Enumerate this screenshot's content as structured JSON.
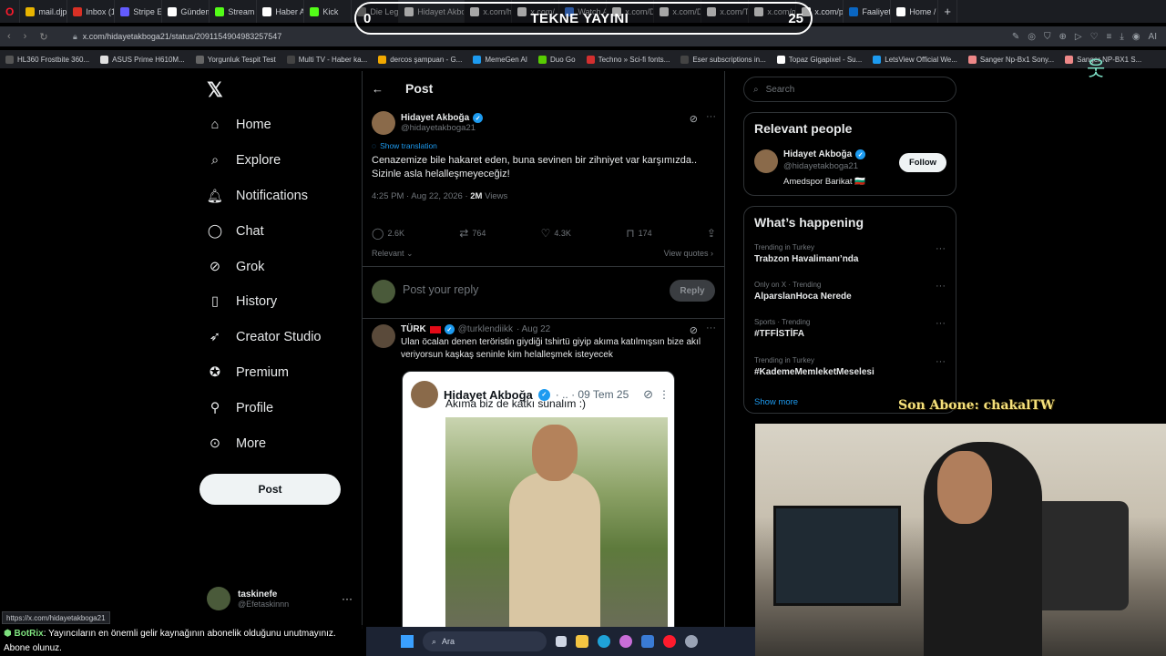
{
  "browser": {
    "tabs": [
      {
        "label": "mail.djp",
        "color": "#e8b400"
      },
      {
        "label": "Inbox (1",
        "color": "#d93025"
      },
      {
        "label": "Stripe E",
        "color": "#635bff"
      },
      {
        "label": "Gündem",
        "color": "#ffffff"
      },
      {
        "label": "Stream",
        "color": "#53fc18"
      },
      {
        "label": "Haber A",
        "color": "#ffffff"
      },
      {
        "label": "Kick",
        "color": "#53fc18"
      },
      {
        "label": "Die Lege",
        "color": "#888888"
      },
      {
        "label": "Hidayet Akboğ",
        "color": "#ffffff",
        "active": true
      },
      {
        "label": "x.com/h",
        "color": "#ffffff"
      },
      {
        "label": "x.com/",
        "color": "#ffffff"
      },
      {
        "label": "Watch A",
        "color": "#4285f4"
      },
      {
        "label": "x.com/D",
        "color": "#ffffff"
      },
      {
        "label": "x.com/D",
        "color": "#ffffff"
      },
      {
        "label": "x.com/Te",
        "color": "#ffffff"
      },
      {
        "label": "x.com/g",
        "color": "#ffffff"
      },
      {
        "label": "x.com/p",
        "color": "#ffffff"
      },
      {
        "label": "Faaliyet",
        "color": "#0a66c2"
      },
      {
        "label": "Home /",
        "color": "#ffffff"
      }
    ],
    "url": "x.com/hidayetakboga21/status/2091154904983257547",
    "bookmarks": [
      {
        "label": "HL360 Frostbite 360...",
        "color": "#555"
      },
      {
        "label": "ASUS Prime H610M...",
        "color": "#e0e0e0"
      },
      {
        "label": "Yorgunluk Tespit Test",
        "color": "#666"
      },
      {
        "label": "Multi TV - Haber ka...",
        "color": "#444"
      },
      {
        "label": "dercos şampuan - G...",
        "color": "#f2a900"
      },
      {
        "label": "MemeGen AI",
        "color": "#1d9bf0"
      },
      {
        "label": "Duo Go",
        "color": "#58cc02"
      },
      {
        "label": "Techno » Sci-fi fonts...",
        "color": "#d32f2f"
      },
      {
        "label": "Eser subscriptions in...",
        "color": "#444"
      },
      {
        "label": "Topaz Gigapixel - Su...",
        "color": "#fff"
      },
      {
        "label": "LetsView Official We...",
        "color": "#1d9bf0"
      },
      {
        "label": "Sanger Np-Bx1 Sony...",
        "color": "#e88"
      },
      {
        "label": "Sanger NP-BX1 S...",
        "color": "#e88"
      }
    ]
  },
  "stream_overlay": {
    "left_num": "0",
    "title": "TEKNE YAYINI",
    "right_num": "25"
  },
  "sidenav": {
    "items": [
      {
        "label": "Home",
        "icon": "home-icon"
      },
      {
        "label": "Explore",
        "icon": "search-icon"
      },
      {
        "label": "Notifications",
        "icon": "bell-icon"
      },
      {
        "label": "Chat",
        "icon": "chat-icon"
      },
      {
        "label": "Grok",
        "icon": "grok-icon"
      },
      {
        "label": "History",
        "icon": "bookmark-icon"
      },
      {
        "label": "Creator Studio",
        "icon": "rocket-icon"
      },
      {
        "label": "Premium",
        "icon": "verified-icon"
      },
      {
        "label": "Profile",
        "icon": "person-icon"
      },
      {
        "label": "More",
        "icon": "more-circle-icon"
      }
    ],
    "post_label": "Post",
    "account": {
      "name": "taskinefe",
      "handle": "@Efetaskinnn"
    }
  },
  "post": {
    "header": "Post",
    "author_name": "Hidayet Akboğa",
    "author_handle": "@hidayetakboga21",
    "show_translation": "Show translation",
    "text": "Cenazemize bile hakaret eden, buna sevinen bir zihniyet var karşımızda.. Sizinle asla helalleşmeyeceğiz!",
    "timestamp": "4:25 PM · Aug 22, 2026 · ",
    "views_count": "2M",
    "views_label": " Views",
    "replies": "2.6K",
    "reposts": "764",
    "likes": "4.3K",
    "bookmarks": "174",
    "sort_label": "Relevant",
    "view_quotes": "View quotes",
    "reply_placeholder": "Post your reply",
    "reply_button": "Reply"
  },
  "reply": {
    "name": "TÜRK",
    "handle": "@turklendiikk",
    "date": "· Aug 22",
    "text": "Ulan öcalan denen teröristin giydiği tshirtü giyip akıma katılmışsın bize akıl veriyorsun kaşkaş seninle kim helalleşmek isteyecek",
    "quote_name": "Hidayet Akboğa",
    "quote_meta": "· .. · 09 Tem 25",
    "quote_text": "Akıma biz de katkı sunalım :)"
  },
  "right": {
    "search_placeholder": "Search",
    "relevant_title": "Relevant people",
    "person_name": "Hidayet Akboğa",
    "person_handle": "@hidayetakboga21",
    "person_bio": "Amedspor Barikat 🇧🇬",
    "follow_label": "Follow",
    "happening_title": "What’s happening",
    "trends": [
      {
        "meta": "Trending in Turkey",
        "topic": "Trabzon Havalimanı’nda"
      },
      {
        "meta": "Only on X · Trending",
        "topic": "AlparslanHoca Nerede"
      },
      {
        "meta": "Sports · Trending",
        "topic": "#TFFİSTİFA"
      },
      {
        "meta": "Trending in Turkey",
        "topic": "#KademeMemleketMeselesi"
      }
    ],
    "show_more": "Show more"
  },
  "overlay": {
    "son_abone": "Son Abone: chakalTW",
    "status_url": "https://x.com/hidayetakboga21",
    "chat_bot": "BotRix",
    "chat_text": ": Yayıncıların en önemli gelir kaynağının abonelik olduğunu unutmayınız. Abone olunuz."
  },
  "taskbar": {
    "search_placeholder": "Ara"
  }
}
